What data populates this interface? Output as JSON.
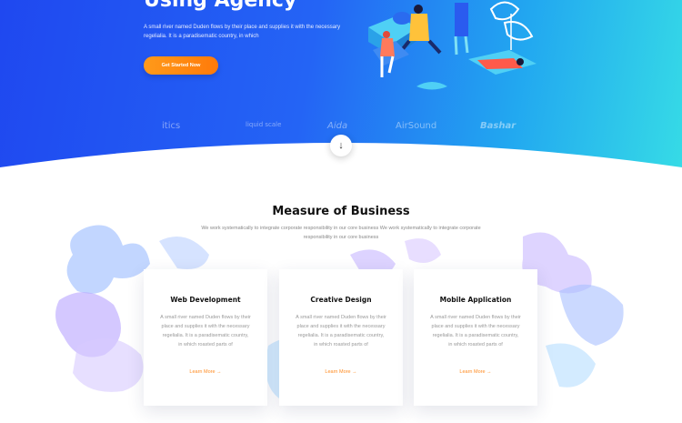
{
  "hero": {
    "title": "Using Agency",
    "description": "A small river named Duden flows by their place and supplies it with the necessary regelialia. It is a paradisematic country, in which",
    "cta_label": "Get Started Now"
  },
  "logos": [
    "itics",
    "liquid scale",
    "Aida",
    "AirSound",
    "Bashar"
  ],
  "scroll_icon": "arrow-down-icon",
  "section": {
    "title": "Measure of Business",
    "subtitle": "We work systematically to integrate corporate responsibility in our core business We work systematically to integrate corporate responsibility in our core business"
  },
  "cards": [
    {
      "title": "Web Development",
      "text": "A small river named Duden flows by their place and supplies it with the necessary regelialia. It is a paradisematic country, in which roasted parts of",
      "link": "Learn More"
    },
    {
      "title": "Creative Design",
      "text": "A small river named Duden flows by their place and supplies it with the necessary regelialia. It is a paradisematic country, in which roasted parts of",
      "link": "Learn More"
    },
    {
      "title": "Mobile Application",
      "text": "A small river named Duden flows by their place and supplies it with the necessary regelialia. It is a paradisematic country, in which roasted parts of",
      "link": "Learn More"
    }
  ],
  "colors": {
    "hero_start": "#1f48f0",
    "hero_end": "#36dbe6",
    "accent": "#ff8a1f"
  }
}
